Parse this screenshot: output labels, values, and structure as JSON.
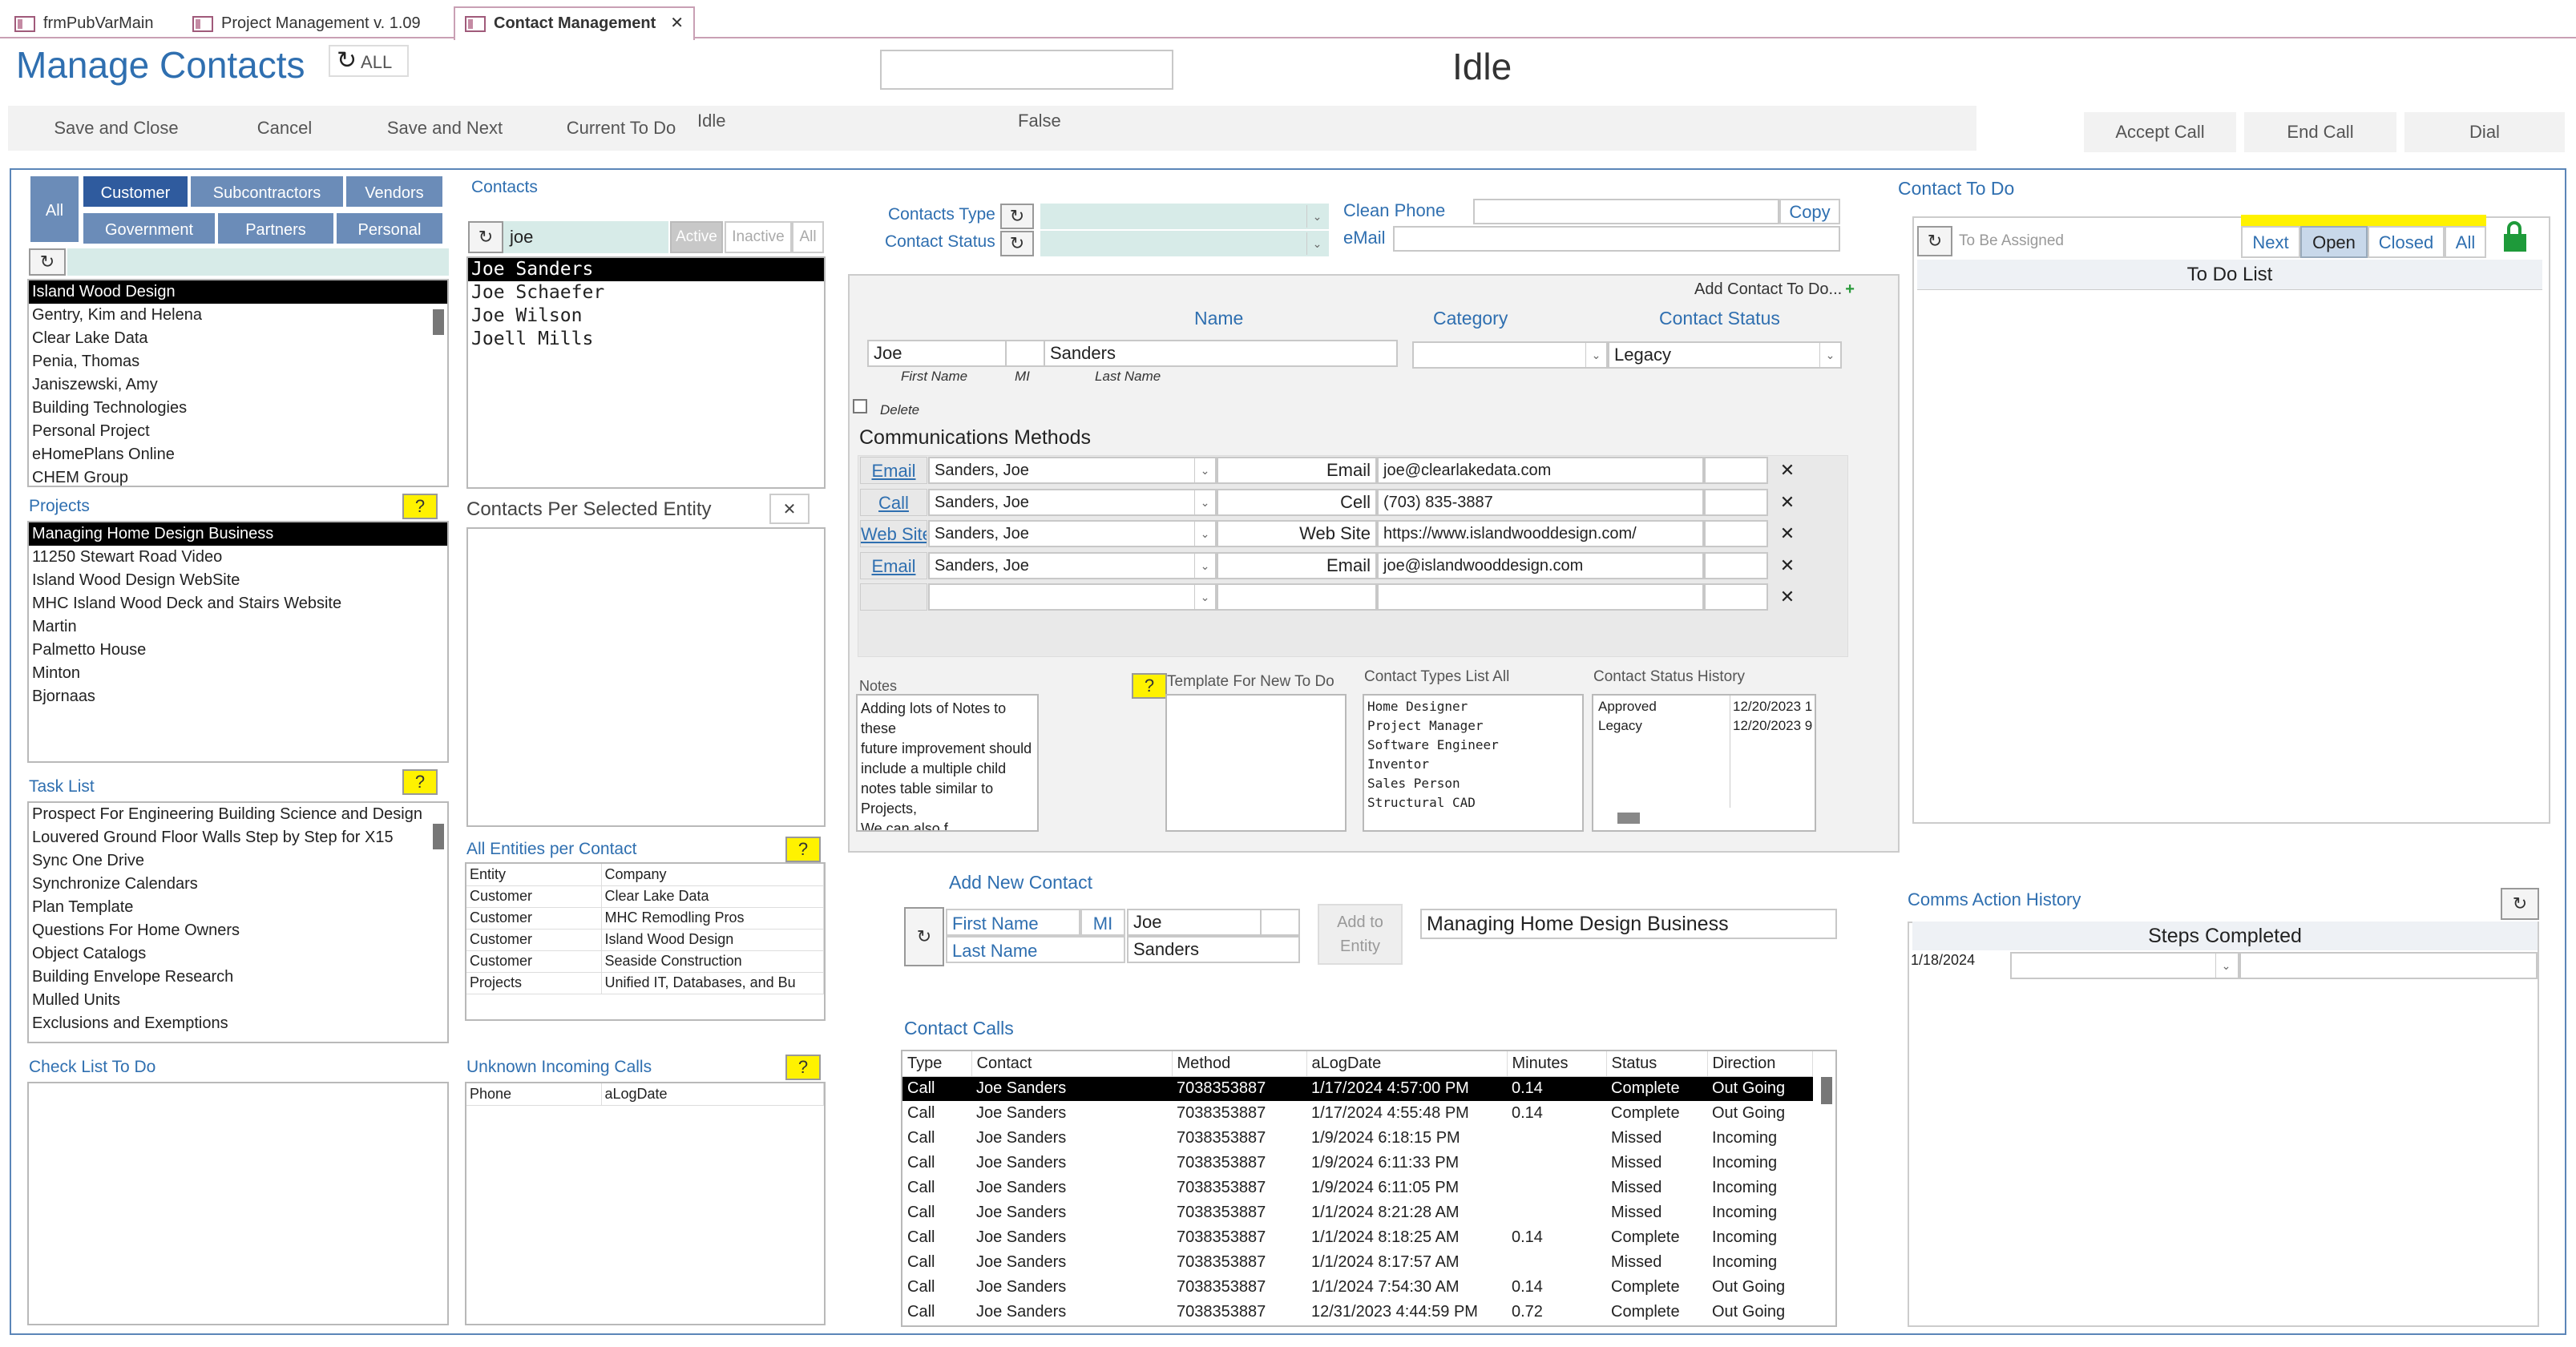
{
  "tabs": [
    {
      "label": "frmPubVarMain"
    },
    {
      "label": "Project Management  v. 1.09"
    },
    {
      "label": "Contact Management"
    }
  ],
  "header": {
    "title": "Manage Contacts",
    "refresh_label": "ALL",
    "search_value": "",
    "status": "Idle"
  },
  "commands": {
    "save_close": "Save and Close",
    "cancel": "Cancel",
    "save_next": "Save and Next",
    "current_todo": "Current To Do",
    "idle": "Idle",
    "false_text": "False",
    "accept_call": "Accept Call",
    "end_call": "End Call",
    "dial": "Dial"
  },
  "entity_tabs": {
    "all": "All",
    "customer": "Customer",
    "subcontractors": "Subcontractors",
    "vendors": "Vendors",
    "government": "Government",
    "partners": "Partners",
    "personal": "Personal"
  },
  "entity_search": "",
  "entities": [
    "Island Wood Design",
    "Gentry, Kim and Helena",
    "Clear Lake Data",
    "Penia, Thomas",
    "Janiszewski, Amy",
    "Building Technologies",
    "Personal Project",
    "eHomePlans Online",
    "CHEM Group"
  ],
  "projects": {
    "label": "Projects",
    "help": "?",
    "items": [
      "Managing Home Design Business",
      "11250 Stewart Road Video",
      "Island Wood Design WebSite",
      "MHC Island Wood Deck and Stairs Website",
      "Martin",
      "Palmetto House",
      "Minton",
      "Bjornaas"
    ]
  },
  "tasks": {
    "label": "Task List",
    "help": "?",
    "items": [
      "Prospect For Engineering Building Science and Design",
      "Louvered Ground Floor Walls Step by Step for X15",
      "Sync One Drive",
      "Synchronize Calendars",
      "Plan Template",
      "Questions For Home Owners",
      "Object Catalogs",
      "Building Envelope Research",
      "Mulled Units",
      "Exclusions and Exemptions"
    ]
  },
  "checklist": {
    "label": "Check List To Do"
  },
  "contacts": {
    "label": "Contacts",
    "search": "joe",
    "active": "Active",
    "inactive": "Inactive",
    "all": "All",
    "items": [
      "Joe Sanders",
      "Joe Schaefer",
      "Joe Wilson",
      "Joell Mills"
    ]
  },
  "per_entity": {
    "label": "Contacts Per Selected Entity",
    "close": "✕"
  },
  "entities_per_contact": {
    "label": "All Entities per Contact",
    "help": "?",
    "headers": [
      "Entity",
      "Company"
    ],
    "rows": [
      [
        "Customer",
        "Clear Lake Data"
      ],
      [
        "Customer",
        "MHC Remodling Pros"
      ],
      [
        "Customer",
        "Island Wood Design"
      ],
      [
        "Customer",
        "Seaside Construction"
      ],
      [
        "Projects",
        "Unified IT,  Databases, and Bu"
      ]
    ]
  },
  "unknown_calls": {
    "label": "Unknown Incoming Calls",
    "help": "?",
    "headers": [
      "Phone",
      "aLogDate"
    ]
  },
  "filters": {
    "contact_type_label": "Contacts Type",
    "contact_status_label": "Contact Status",
    "clean_phone_label": "Clean  Phone",
    "copy": "Copy",
    "email_label": "eMail"
  },
  "detail": {
    "add_todo": "Add Contact To Do...",
    "name_header": "Name",
    "category_header": "Category",
    "status_header": "Contact Status",
    "first": "Joe",
    "mi": "",
    "last": "Sanders",
    "first_label": "First Name",
    "mi_label": "MI",
    "last_label": "Last Name",
    "category": "",
    "status": "Legacy",
    "delete_label": "Delete",
    "comms_label": "Communications Methods"
  },
  "comms": [
    {
      "type": "Email",
      "owner": "Sanders, Joe",
      "kind": "Email",
      "value": "joe@clearlakedata.com"
    },
    {
      "type": "Call",
      "owner": "Sanders, Joe",
      "kind": "Cell",
      "value": "(703) 835-3887"
    },
    {
      "type": "Web Site",
      "owner": "Sanders, Joe",
      "kind": "Web Site",
      "value": "https://www.islandwooddesign.com/"
    },
    {
      "type": "Email",
      "owner": "Sanders, Joe",
      "kind": "Email",
      "value": "joe@islandwooddesign.com"
    },
    {
      "type": "",
      "owner": "",
      "kind": "",
      "value": ""
    }
  ],
  "notes": {
    "label": "Notes",
    "text": "Adding lots of Notes to these\nfuture improvement should include a multiple child notes table similar to Projects,\nWe can also f"
  },
  "template": {
    "label": "Template For New To Do",
    "help": "?"
  },
  "types_list": {
    "label": "Contact Types List All",
    "items": [
      "Home Designer",
      "Project Manager",
      "Software Engineer",
      "Inventor",
      "Sales Person",
      "Structural CAD"
    ]
  },
  "status_history": {
    "label": "Contact Status History",
    "rows": [
      [
        "Approved",
        "12/20/2023 1"
      ],
      [
        "Legacy",
        "12/20/2023 9"
      ]
    ]
  },
  "add_contact": {
    "label": "Add New Contact",
    "first_label": "First Name",
    "mi_label": "MI",
    "last_label": "Last Name",
    "first": "Joe",
    "last": "Sanders",
    "add_btn": "Add to Entity",
    "project": "Managing Home Design Business"
  },
  "calls": {
    "label": "Contact Calls",
    "headers": [
      "Type",
      "Contact",
      "Method",
      "aLogDate",
      "Minutes",
      "Status",
      "Direction"
    ],
    "rows": [
      [
        "Call",
        "Joe Sanders",
        "7038353887",
        "1/17/2024 4:57:00 PM",
        "0.14",
        "Complete",
        "Out Going"
      ],
      [
        "Call",
        "Joe Sanders",
        "7038353887",
        "1/17/2024 4:55:48 PM",
        "0.14",
        "Complete",
        "Out Going"
      ],
      [
        "Call",
        "Joe Sanders",
        "7038353887",
        "1/9/2024 6:18:15 PM",
        "",
        "Missed",
        "Incoming"
      ],
      [
        "Call",
        "Joe Sanders",
        "7038353887",
        "1/9/2024 6:11:33 PM",
        "",
        "Missed",
        "Incoming"
      ],
      [
        "Call",
        "Joe Sanders",
        "7038353887",
        "1/9/2024 6:11:05 PM",
        "",
        "Missed",
        "Incoming"
      ],
      [
        "Call",
        "Joe Sanders",
        "7038353887",
        "1/1/2024 8:21:28 AM",
        "",
        "Missed",
        "Incoming"
      ],
      [
        "Call",
        "Joe Sanders",
        "7038353887",
        "1/1/2024 8:18:25 AM",
        "0.14",
        "Complete",
        "Incoming"
      ],
      [
        "Call",
        "Joe Sanders",
        "7038353887",
        "1/1/2024 8:17:57 AM",
        "",
        "Missed",
        "Incoming"
      ],
      [
        "Call",
        "Joe Sanders",
        "7038353887",
        "1/1/2024 7:54:30 AM",
        "0.14",
        "Complete",
        "Out Going"
      ],
      [
        "Call",
        "Joe Sanders",
        "7038353887",
        "12/31/2023 4:44:59 PM",
        "0.72",
        "Complete",
        "Out Going"
      ]
    ]
  },
  "todo": {
    "label": "Contact To Do",
    "assigned": "To Be Assigned",
    "next": "Next",
    "open": "Open",
    "closed": "Closed",
    "all": "All",
    "list_title": "To Do List"
  },
  "comms_history": {
    "label": "Comms Action History",
    "steps": "Steps Completed",
    "date": "1/18/2024"
  }
}
